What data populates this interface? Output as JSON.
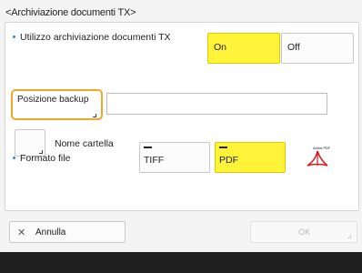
{
  "title": "<Archiviazione documenti TX>",
  "usage": {
    "label": "Utilizzo archiviazione documenti TX",
    "on_label": "On",
    "off_label": "Off",
    "selected": "On"
  },
  "backup": {
    "button_label": "Posizione backup",
    "value": ""
  },
  "folder": {
    "label": "Nome cartella"
  },
  "file_format": {
    "label": "Formato file",
    "options": [
      "TIFF",
      "PDF"
    ],
    "selected": "PDF",
    "pdf_logo_text": "Adobe PDF"
  },
  "footer": {
    "cancel_label": "Annulla",
    "ok_label": "OK"
  },
  "colors": {
    "selected": "#fff33a",
    "focus_border": "#f3a72a",
    "accent_bullet": "#3a86c8"
  }
}
